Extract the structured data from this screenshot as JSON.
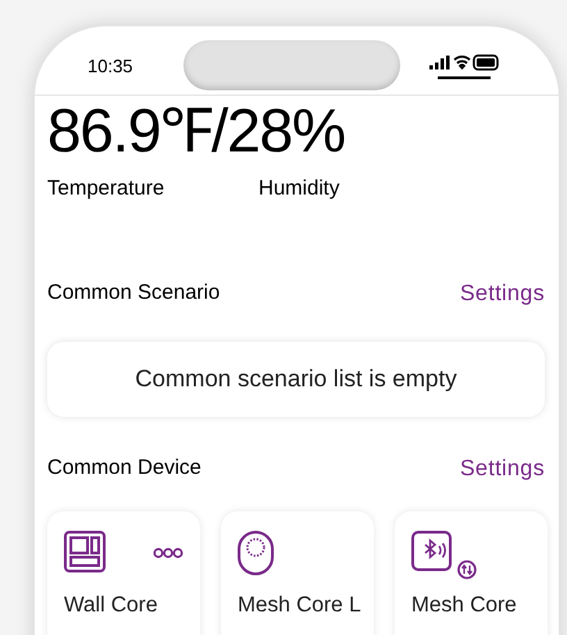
{
  "status_bar": {
    "time": "10:35"
  },
  "climate": {
    "reading": "86.9℉/28%",
    "labels": [
      "Temperature",
      "Humidity"
    ]
  },
  "scenario_section": {
    "title": "Common Scenario",
    "action": "Settings",
    "empty_message": "Common scenario list is empty"
  },
  "device_section": {
    "title": "Common Device",
    "action": "Settings",
    "devices": [
      {
        "kind": "wall",
        "name": "Wall Core",
        "has_more": true
      },
      {
        "kind": "mesh",
        "name": "Mesh Core L",
        "has_more": false
      },
      {
        "kind": "bluetooth",
        "name": "Mesh Core",
        "has_more": false
      }
    ]
  }
}
